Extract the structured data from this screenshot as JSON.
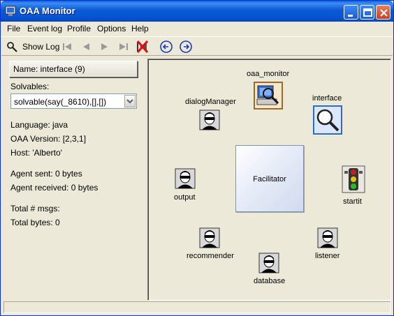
{
  "window": {
    "title": "OAA Monitor"
  },
  "menu": [
    "File",
    "Event log",
    "Profile",
    "Options",
    "Help"
  ],
  "toolbar": {
    "show_log_label": "Show Log",
    "icons": [
      "binoculars-icon",
      "first-icon",
      "previous-icon",
      "next-icon",
      "last-icon",
      "clear-icon",
      "rewind-icon",
      "forward-icon"
    ]
  },
  "agent_panel": {
    "name_button": "Name: interface (9)",
    "solvables_label": "Solvables:",
    "solvables_value": "solvable(say(_8610),[],[])",
    "language": "Language: java",
    "oaa_version": "OAA Version: [2,3,1]",
    "host": "Host: 'Alberto'",
    "agent_sent": "Agent sent: 0 bytes",
    "agent_received": "Agent received: 0 bytes",
    "total_msgs": "Total # msgs:",
    "total_bytes": "Total bytes: 0"
  },
  "canvas": {
    "facilitator": "Facilitator",
    "agents": {
      "oaa_monitor": "oaa_monitor",
      "interface": "interface",
      "dialogManager": "dialogManager",
      "output": "output",
      "startit": "startit",
      "recommender": "recommender",
      "listener": "listener",
      "database": "database"
    }
  },
  "colors": {
    "titlebar": "#0a5ad6",
    "accent": "#316ac5",
    "background": "#ece9d8"
  }
}
